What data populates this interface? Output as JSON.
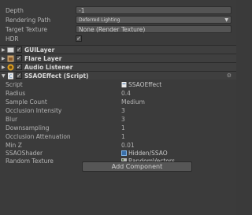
{
  "camera": {
    "depth": {
      "label": "Depth",
      "value": "-1"
    },
    "rendering_path": {
      "label": "Rendering Path",
      "value": "Deferred Lighting"
    },
    "target_texture": {
      "label": "Target Texture",
      "value": "None (Render Texture)"
    },
    "hdr": {
      "label": "HDR",
      "checked": true
    }
  },
  "components": [
    {
      "name": "GUILayer",
      "enabled": true,
      "icon": "gui-layer-icon"
    },
    {
      "name": "Flare Layer",
      "enabled": true,
      "icon": "flare-layer-icon"
    },
    {
      "name": "Audio Listener",
      "enabled": true,
      "icon": "audio-listener-icon"
    },
    {
      "name": "SSAOEffect (Script)",
      "enabled": true,
      "icon": "script-icon"
    }
  ],
  "ssao": {
    "props": [
      {
        "label": "Script",
        "value": "SSAOEffect"
      },
      {
        "label": "Radius",
        "value": "0.4"
      },
      {
        "label": "Sample Count",
        "value": "Medium"
      },
      {
        "label": "Occlusion Intensity",
        "value": "3"
      },
      {
        "label": "Blur",
        "value": "3"
      },
      {
        "label": "Downsampling",
        "value": "1"
      },
      {
        "label": "Occlusion Attenuation",
        "value": "1"
      },
      {
        "label": "Min Z",
        "value": "0.01"
      },
      {
        "label": "SSAOShader",
        "value": "Hidden/SSAO"
      },
      {
        "label": "Random Texture",
        "value": "RandomVectors"
      }
    ]
  },
  "add_component_label": "Add Component",
  "colors": {
    "background": "#3b3b3b",
    "field": "#545454",
    "text": "#b4b4b4"
  }
}
